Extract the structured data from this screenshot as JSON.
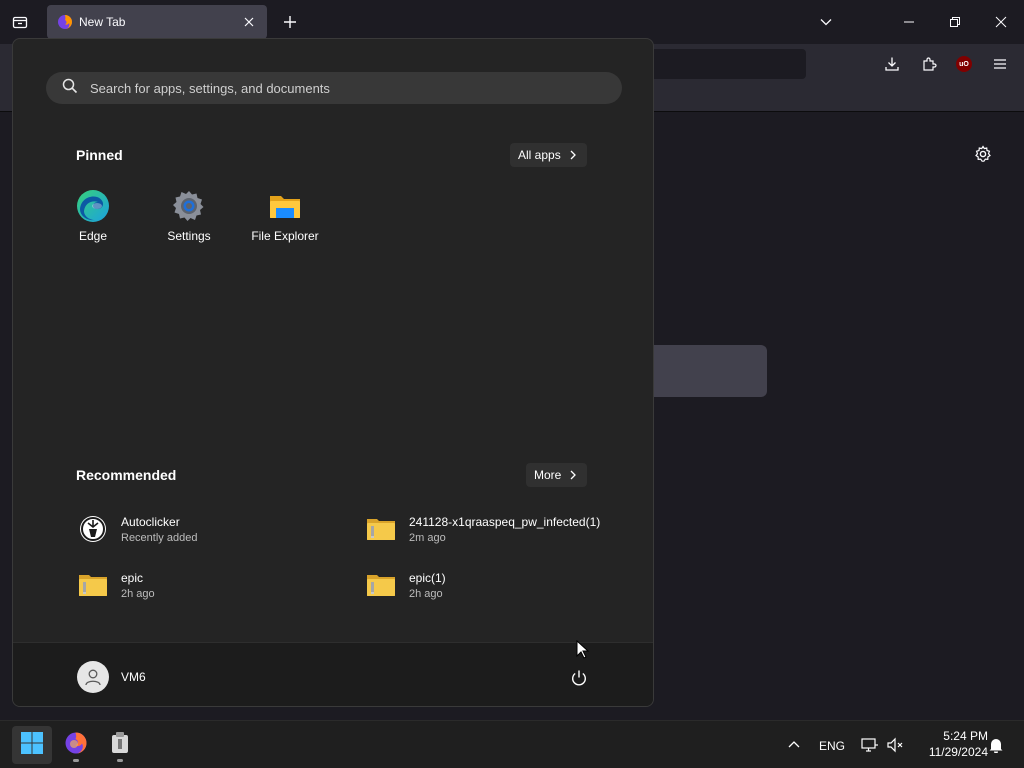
{
  "browser": {
    "tab": {
      "title": "New Tab"
    },
    "colors": {
      "accent": "#0060df",
      "ublock": "#800000"
    }
  },
  "start_menu": {
    "search": {
      "placeholder": "Search for apps, settings, and documents"
    },
    "pinned": {
      "title": "Pinned",
      "all_apps_label": "All apps",
      "apps": [
        {
          "label": "Edge",
          "icon": "edge-icon"
        },
        {
          "label": "Settings",
          "icon": "settings-gear-icon"
        },
        {
          "label": "File Explorer",
          "icon": "file-explorer-icon"
        }
      ]
    },
    "recommended": {
      "title": "Recommended",
      "more_label": "More",
      "items": [
        {
          "name": "Autoclicker",
          "sub": "Recently added",
          "icon": "autoclicker-icon"
        },
        {
          "name": "241128-x1qraaspeq_pw_infected(1)",
          "sub": "2m ago",
          "icon": "zip-folder-icon"
        },
        {
          "name": "epic",
          "sub": "2h ago",
          "icon": "zip-folder-icon"
        },
        {
          "name": "epic(1)",
          "sub": "2h ago",
          "icon": "zip-folder-icon"
        }
      ]
    },
    "user": {
      "name": "VM6"
    }
  },
  "taskbar": {
    "language": "ENG",
    "time": "5:24 PM",
    "date": "11/29/2024"
  }
}
